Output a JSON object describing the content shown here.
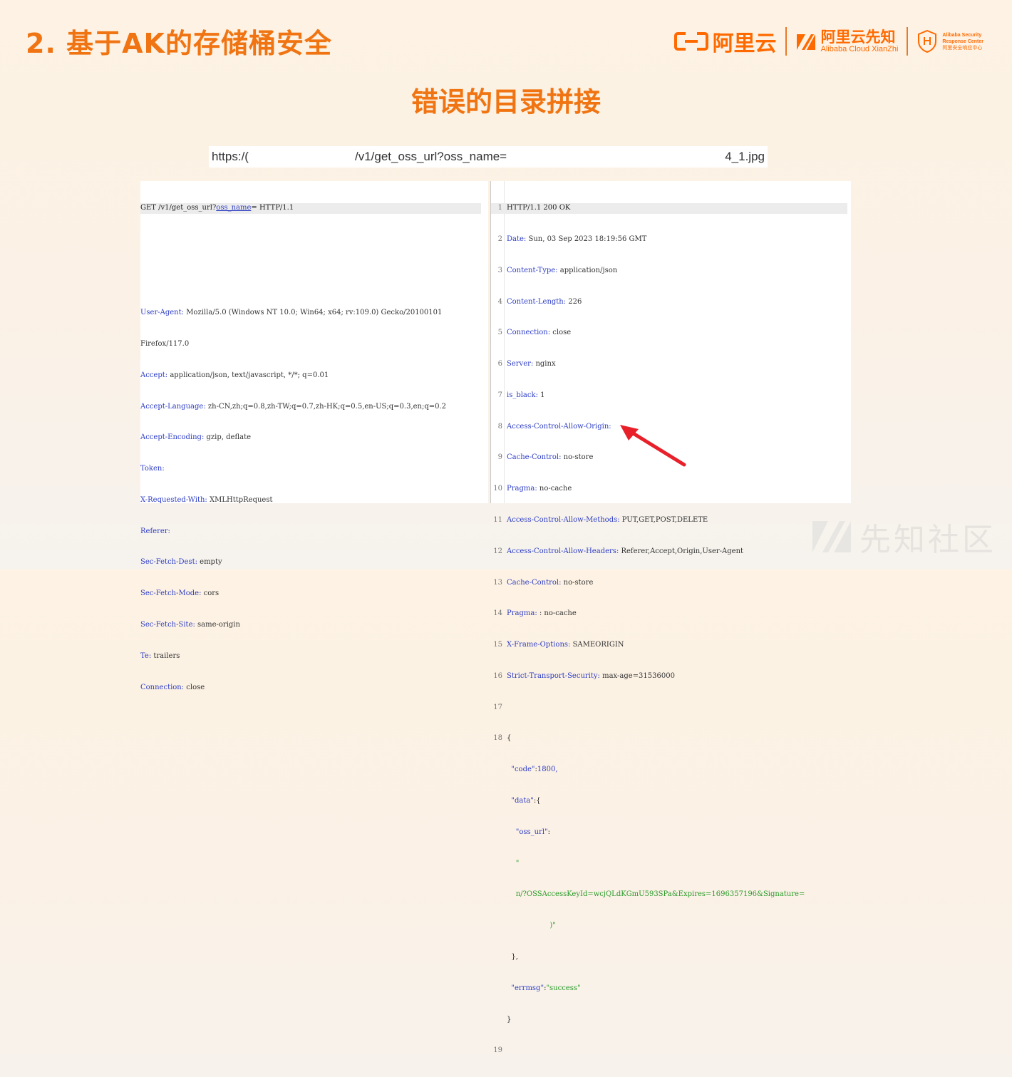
{
  "slide": {
    "title": "2. 基于AK的存储桶安全",
    "subtitle": "错误的目录拼接"
  },
  "logos": {
    "aliyun": "阿里云",
    "xianzhi_cn": "阿里云先知",
    "xianzhi_en": "Alibaba Cloud XianZhi",
    "asrc_line1": "Alibaba Security",
    "asrc_line2": "Response Center",
    "asrc_cn": "阿里安全响应中心"
  },
  "url_bar": {
    "part1": "https:/(",
    "part2": "/v1/get_oss_url?oss_name=",
    "part3": "4_1.jpg"
  },
  "request": {
    "request_line_pre": "GET /v1/get_oss_url?",
    "request_line_param": "oss_name",
    "request_line_post": "= HTTP/1.1",
    "headers": [
      {
        "k": "User-Agent",
        "v": " Mozilla/5.0 (Windows NT 10.0; Win64; x64; rv:109.0) Gecko/20100101"
      },
      {
        "k": "",
        "v": "Firefox/117.0"
      },
      {
        "k": "Accept",
        "v": " application/json, text/javascript, */*; q=0.01"
      },
      {
        "k": "Accept-Language",
        "v": " zh-CN,zh;q=0.8,zh-TW;q=0.7,zh-HK;q=0.5,en-US;q=0.3,en;q=0.2"
      },
      {
        "k": "Accept-Encoding",
        "v": " gzip, deflate"
      },
      {
        "k": "Token",
        "v": ""
      },
      {
        "k": "X-Requested-With",
        "v": " XMLHttpRequest"
      },
      {
        "k": "Referer",
        "v": ""
      },
      {
        "k": "Sec-Fetch-Dest",
        "v": " empty"
      },
      {
        "k": "Sec-Fetch-Mode",
        "v": " cors"
      },
      {
        "k": "Sec-Fetch-Site",
        "v": " same-origin"
      },
      {
        "k": "Te",
        "v": " trailers"
      },
      {
        "k": "Connection",
        "v": " close"
      }
    ]
  },
  "response": {
    "status_line": "HTTP/1.1 200 OK",
    "headers": [
      {
        "n": "2",
        "k": "Date",
        "v": " Sun, 03 Sep 2023 18:19:56 GMT"
      },
      {
        "n": "3",
        "k": "Content-Type",
        "v": " application/json"
      },
      {
        "n": "4",
        "k": "Content-Length",
        "v": " 226"
      },
      {
        "n": "5",
        "k": "Connection",
        "v": " close"
      },
      {
        "n": "6",
        "k": "Server",
        "v": " nginx"
      },
      {
        "n": "7",
        "k": "is_black",
        "v": " 1"
      },
      {
        "n": "8",
        "k": "Access-Control-Allow-Origin",
        "v": ""
      },
      {
        "n": "9",
        "k": "Cache-Control",
        "v": " no-store"
      },
      {
        "n": "10",
        "k": "Pragma",
        "v": " no-cache"
      },
      {
        "n": "11",
        "k": "Access-Control-Allow-Methods",
        "v": " PUT,GET,POST,DELETE"
      },
      {
        "n": "12",
        "k": "Access-Control-Allow-Headers",
        "v": " Referer,Accept,Origin,User-Agent"
      },
      {
        "n": "13",
        "k": "Cache-Control",
        "v": " no-store"
      },
      {
        "n": "14",
        "k": "Pragma",
        "v": " : no-cache"
      },
      {
        "n": "15",
        "k": "X-Frame-Options",
        "v": " SAMEORIGIN"
      },
      {
        "n": "16",
        "k": "Strict-Transport-Security",
        "v": " max-age=31536000"
      }
    ],
    "line_numbers": [
      "1",
      "17",
      "18",
      "19"
    ],
    "body": {
      "open": "{",
      "code_key": "\"code\"",
      "code_val": "1800,",
      "data_key": "\"data\"",
      "data_open": ":{",
      "oss_url_key": "\"oss_url\"",
      "colon": ":",
      "quote": "\"",
      "url_value": "n/?OSSAccessKeyId=wcjQLdKGmU593SPa&Expires=1696357196&Signature=",
      "url_end": ")\"",
      "data_close": "},",
      "errmsg_key": "\"errmsg\"",
      "errmsg_val": "\"success\"",
      "close": "}"
    }
  },
  "watermark": {
    "text": "先知社区"
  },
  "colors": {
    "accent": "#f07412",
    "brand": "#ff6a00",
    "header_key": "#2d3dc4",
    "json_string": "#2a9a2a",
    "arrow": "#e8202a"
  }
}
